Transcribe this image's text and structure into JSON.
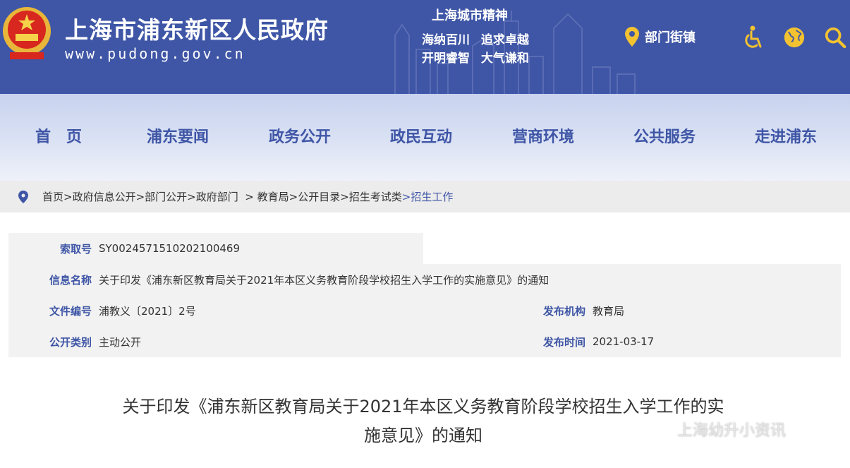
{
  "header": {
    "site_title": "上海市浦东新区人民政府",
    "site_url": "www.pudong.gov.cn",
    "spirit_title": "上海城市精神",
    "spirit_line1": [
      "海纳百川",
      "追求卓越"
    ],
    "spirit_line2": [
      "开明睿智",
      "大气谦和"
    ],
    "dept_link": "部门街镇",
    "icons": [
      "location-pin-icon",
      "accessibility-icon",
      "globe-icon",
      "search-icon"
    ],
    "colors": {
      "brand": "#3f56a6",
      "accent": "#f2c230"
    }
  },
  "nav": {
    "items": [
      "首　页",
      "浦东要闻",
      "政务公开",
      "政民互动",
      "营商环境",
      "公共服务",
      "走进浦东"
    ]
  },
  "breadcrumb": {
    "items": [
      "首页",
      ">政府信息公开",
      ">部门公开",
      ">政府部门",
      "  > 教育局",
      ">公开目录",
      ">招生考试类",
      ">招生工作"
    ]
  },
  "info": {
    "index_label": "索取号",
    "index_value": "SY0024571510202100469",
    "name_label": "信息名称",
    "name_value": "关于印发《浦东新区教育局关于2021年本区义务教育阶段学校招生入学工作的实施意见》的通知",
    "doc_no_label": "文件编号",
    "doc_no_value": "浦教义〔2021〕2号",
    "org_label": "发布机构",
    "org_value": "教育局",
    "category_label": "公开类别",
    "category_value": "主动公开",
    "date_label": "发布时间",
    "date_value": "2021-03-17"
  },
  "article": {
    "title_line1": "关于印发《浦东新区教育局关于2021年本区义务教育阶段学校招生入学工作的实",
    "title_line2": "施意见》的通知"
  },
  "watermark": {
    "text": "上海幼升小资讯"
  }
}
